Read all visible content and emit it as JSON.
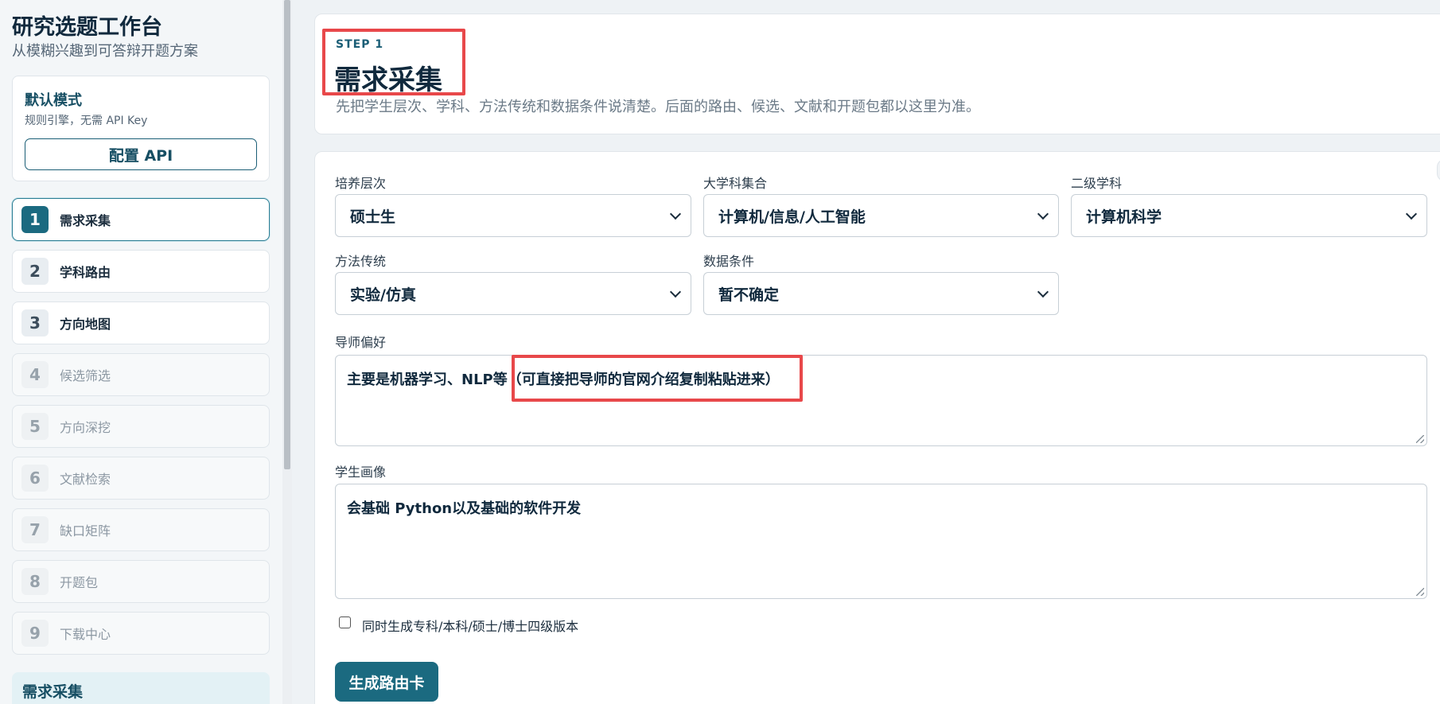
{
  "app": {
    "title": "研究选题工作台",
    "subtitle": "从模糊兴趣到可答辩开题方案"
  },
  "mode": {
    "title": "默认模式",
    "desc": "规则引擎，无需 API Key",
    "api_button": "配置 API"
  },
  "steps": [
    {
      "num": "1",
      "label": "需求采集"
    },
    {
      "num": "2",
      "label": "学科路由"
    },
    {
      "num": "3",
      "label": "方向地图"
    },
    {
      "num": "4",
      "label": "候选筛选"
    },
    {
      "num": "5",
      "label": "方向深挖"
    },
    {
      "num": "6",
      "label": "文献检索"
    },
    {
      "num": "7",
      "label": "缺口矩阵"
    },
    {
      "num": "8",
      "label": "开题包"
    },
    {
      "num": "9",
      "label": "下载中心"
    }
  ],
  "current_section": "需求采集",
  "header": {
    "kicker": "STEP 1",
    "title": "需求采集",
    "desc": "先把学生层次、学科、方法传统和数据条件说清楚。后面的路由、候选、文献和开题包都以这里为准。"
  },
  "form": {
    "level": {
      "label": "培养层次",
      "value": "硕士生"
    },
    "discipline_group": {
      "label": "大学科集合",
      "value": "计算机/信息/人工智能"
    },
    "subdiscipline": {
      "label": "二级学科",
      "value": "计算机科学"
    },
    "method": {
      "label": "方法传统",
      "value": "实验/仿真"
    },
    "data": {
      "label": "数据条件",
      "value": "暂不确定"
    },
    "mentor": {
      "label": "导师偏好",
      "value": "主要是机器学习、NLP等（可直接把导师的官网介绍复制粘贴进来）"
    },
    "profile": {
      "label": "学生画像",
      "value": "会基础 Python以及基础的软件开发"
    },
    "four_levels_checkbox": "同时生成专科/本科/硕士/博士四级版本",
    "generate_button": "生成路由卡"
  }
}
